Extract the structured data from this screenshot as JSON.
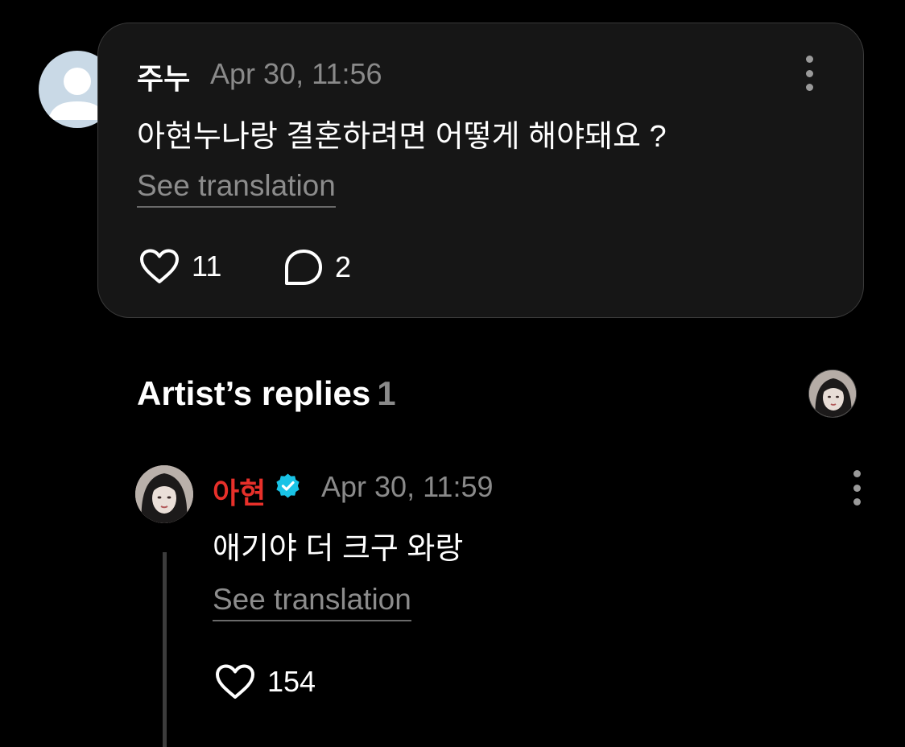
{
  "comment": {
    "username": "주누",
    "timestamp": "Apr 30, 11:56",
    "text": "아현누나랑 결혼하려면 어떻게 해야돼요 ?",
    "see_translation": "See translation",
    "like_count": "11",
    "reply_count": "2",
    "icons": {
      "avatar": "default-user-avatar",
      "menu": "more-vertical-icon",
      "like": "heart-icon",
      "reply": "comment-bubble-icon"
    }
  },
  "artist_replies": {
    "title": "Artist’s replies",
    "count": "1"
  },
  "reply": {
    "artist_name": "아현",
    "timestamp": "Apr 30, 11:59",
    "text": "애기야 더 크구 와랑",
    "see_translation": "See translation",
    "like_count": "154",
    "icons": {
      "verified": "verified-badge-icon",
      "menu": "more-vertical-icon",
      "like": "heart-icon"
    }
  },
  "colors": {
    "background": "#000000",
    "card": "#161616",
    "artist_name": "#e8302a",
    "verified": "#19c3e6",
    "muted_text": "#8a8a8a"
  }
}
